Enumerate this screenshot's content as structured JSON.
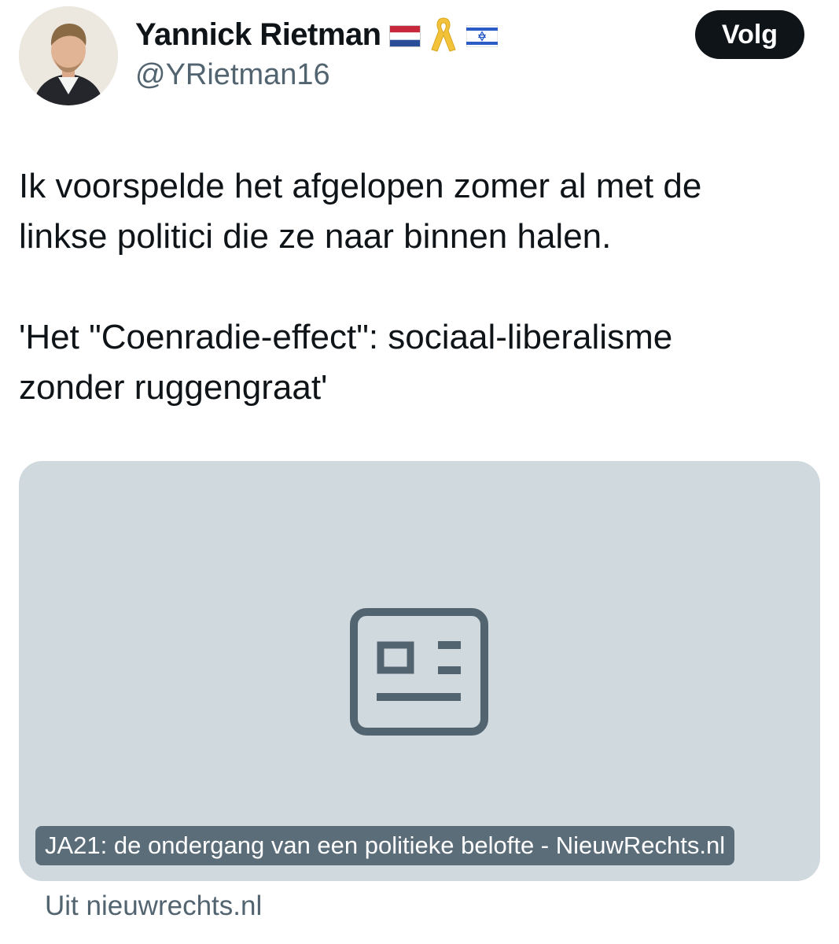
{
  "author": {
    "display_name": "Yannick Rietman",
    "handle": "@YRietman16",
    "badges": [
      "netherlands-flag-icon",
      "yellow-ribbon-icon",
      "israel-flag-icon"
    ]
  },
  "follow_button": {
    "label": "Volg"
  },
  "tweet": {
    "paragraphs": [
      "Ik voorspelde het afgelopen zomer al met de\nlinkse politici die ze naar binnen halen.",
      "'Het \"Coenradie-effect\": sociaal-liberalisme\nzonder ruggengraat'"
    ]
  },
  "link_card": {
    "icon": "article-placeholder-icon",
    "title": "JA21: de ondergang van een politieke belofte - NieuwRechts.nl",
    "source": "Uit nieuwrechts.nl"
  },
  "colors": {
    "text_primary": "#0f1419",
    "text_secondary": "#536471",
    "card_background": "#cfd9de",
    "button_background": "#0f1419",
    "ribbon": "#f2c23a"
  }
}
